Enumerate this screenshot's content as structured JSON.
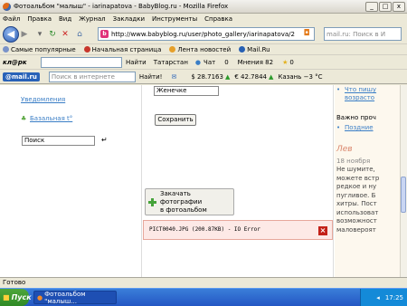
{
  "window": {
    "title": "Фотоальбом \"малыш\" - iarinapatova - BabyBlog.ru - Mozilla Firefox",
    "min": "_",
    "max": "□",
    "close": "x"
  },
  "menu": [
    "Файл",
    "Правка",
    "Вид",
    "Журнал",
    "Закладки",
    "Инструменты",
    "Справка"
  ],
  "nav": {
    "url": "http://www.babyblog.ru/user/photo_gallery/iarinapatova/2",
    "search_placeholder": "mail.ru: Поиск в И"
  },
  "bookmarks": [
    "Самые популярные",
    "Начальная страница",
    "Лента новостей",
    "Mail.Ru"
  ],
  "toolbar1": {
    "brand": "кл@рк",
    "find": "Найти",
    "region": "Татарстан",
    "chat": "Чат",
    "count_a": "0",
    "opinions": "Мнения 82",
    "count_b": "0"
  },
  "toolbar2": {
    "brand": "@mail.ru",
    "search_placeholder": "Поиск в интернете",
    "find": "Найти!",
    "usd": "$ 28.7163",
    "eur": "€ 42.7844",
    "weather": "Казань −3 °C"
  },
  "left": {
    "notifications": "Уведомления",
    "base": "Базальная t°",
    "search_value": "Поиск"
  },
  "middle": {
    "select_value": "Женечке",
    "save": "Сохранить",
    "upload": [
      "Закачать фотографии",
      "в фотоальбом"
    ],
    "error": "PICT0040.JPG (200.87KB) - IO Error"
  },
  "right": {
    "top_link1": "Что пишу",
    "top_link2": "возрасто",
    "important": "Важно проч",
    "latest": "Поздние",
    "sign": "Лев",
    "date": "18 ноября",
    "text": [
      "Не шумите,",
      "можете встр",
      "редкое и ну",
      "пугливое. Б",
      "хитры. Пост",
      "использоват",
      "возможност",
      "маловероят"
    ]
  },
  "status": "Готово",
  "taskbar": {
    "start": "Пуск",
    "item": "Фотоальбом \"малыш...",
    "time": "17:25"
  },
  "colors": {
    "link": "#3a7ec6",
    "sign": "#d9846a",
    "error_bg": "#fde9e6"
  }
}
